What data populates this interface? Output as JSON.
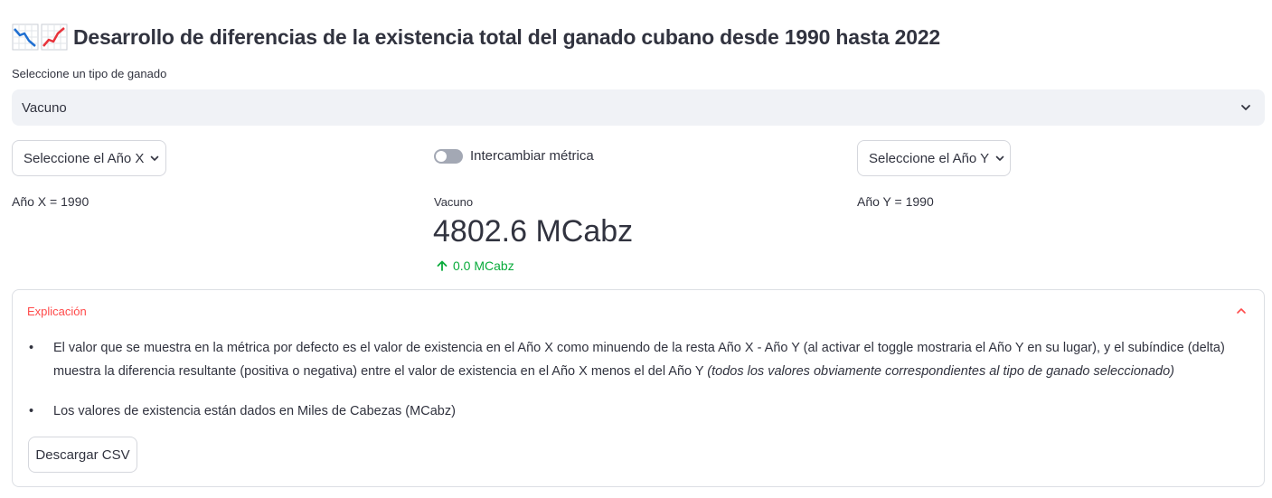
{
  "header": {
    "icons": [
      "chart-decreasing-icon",
      "chart-increasing-icon"
    ],
    "title": "Desarrollo de diferencias de la existencia total del ganado cubano desde 1990 hasta 2022"
  },
  "livestock_select": {
    "label": "Seleccione un tipo de ganado",
    "value": "Vacuno"
  },
  "year_x": {
    "button_label": "Seleccione el Año X",
    "display": "Año X = 1990"
  },
  "year_y": {
    "button_label": "Seleccione el Año Y",
    "display": "Año Y = 1990"
  },
  "toggle": {
    "label": "Intercambiar métrica",
    "on": false
  },
  "metric": {
    "label": "Vacuno",
    "value": "4802.6 MCabz",
    "delta": "0.0 MCabz",
    "delta_direction": "up"
  },
  "expander": {
    "title": "Explicación",
    "expanded": true,
    "bullet1_main": "El valor que se muestra en la métrica por defecto es el valor de existencia en el Año X como minuendo de la resta Año X - Año Y (al activar el toggle mostraria el Año Y en su lugar), y el subíndice (delta) muestra la diferencia resultante (positiva o negativa) entre el valor de existencia en el Año X menos el del Año Y",
    "bullet1_italic": "(todos los valores obviamente correspondientes al tipo de ganado seleccionado)",
    "bullet2": "Los valores de existencia están dados en Miles de Cabezas (MCabz)",
    "download_label": "Descargar CSV"
  },
  "colors": {
    "accent": "#ff4b4b",
    "delta_positive": "#09ab3b",
    "text": "#31333f",
    "select_bg": "#f0f2f6"
  }
}
